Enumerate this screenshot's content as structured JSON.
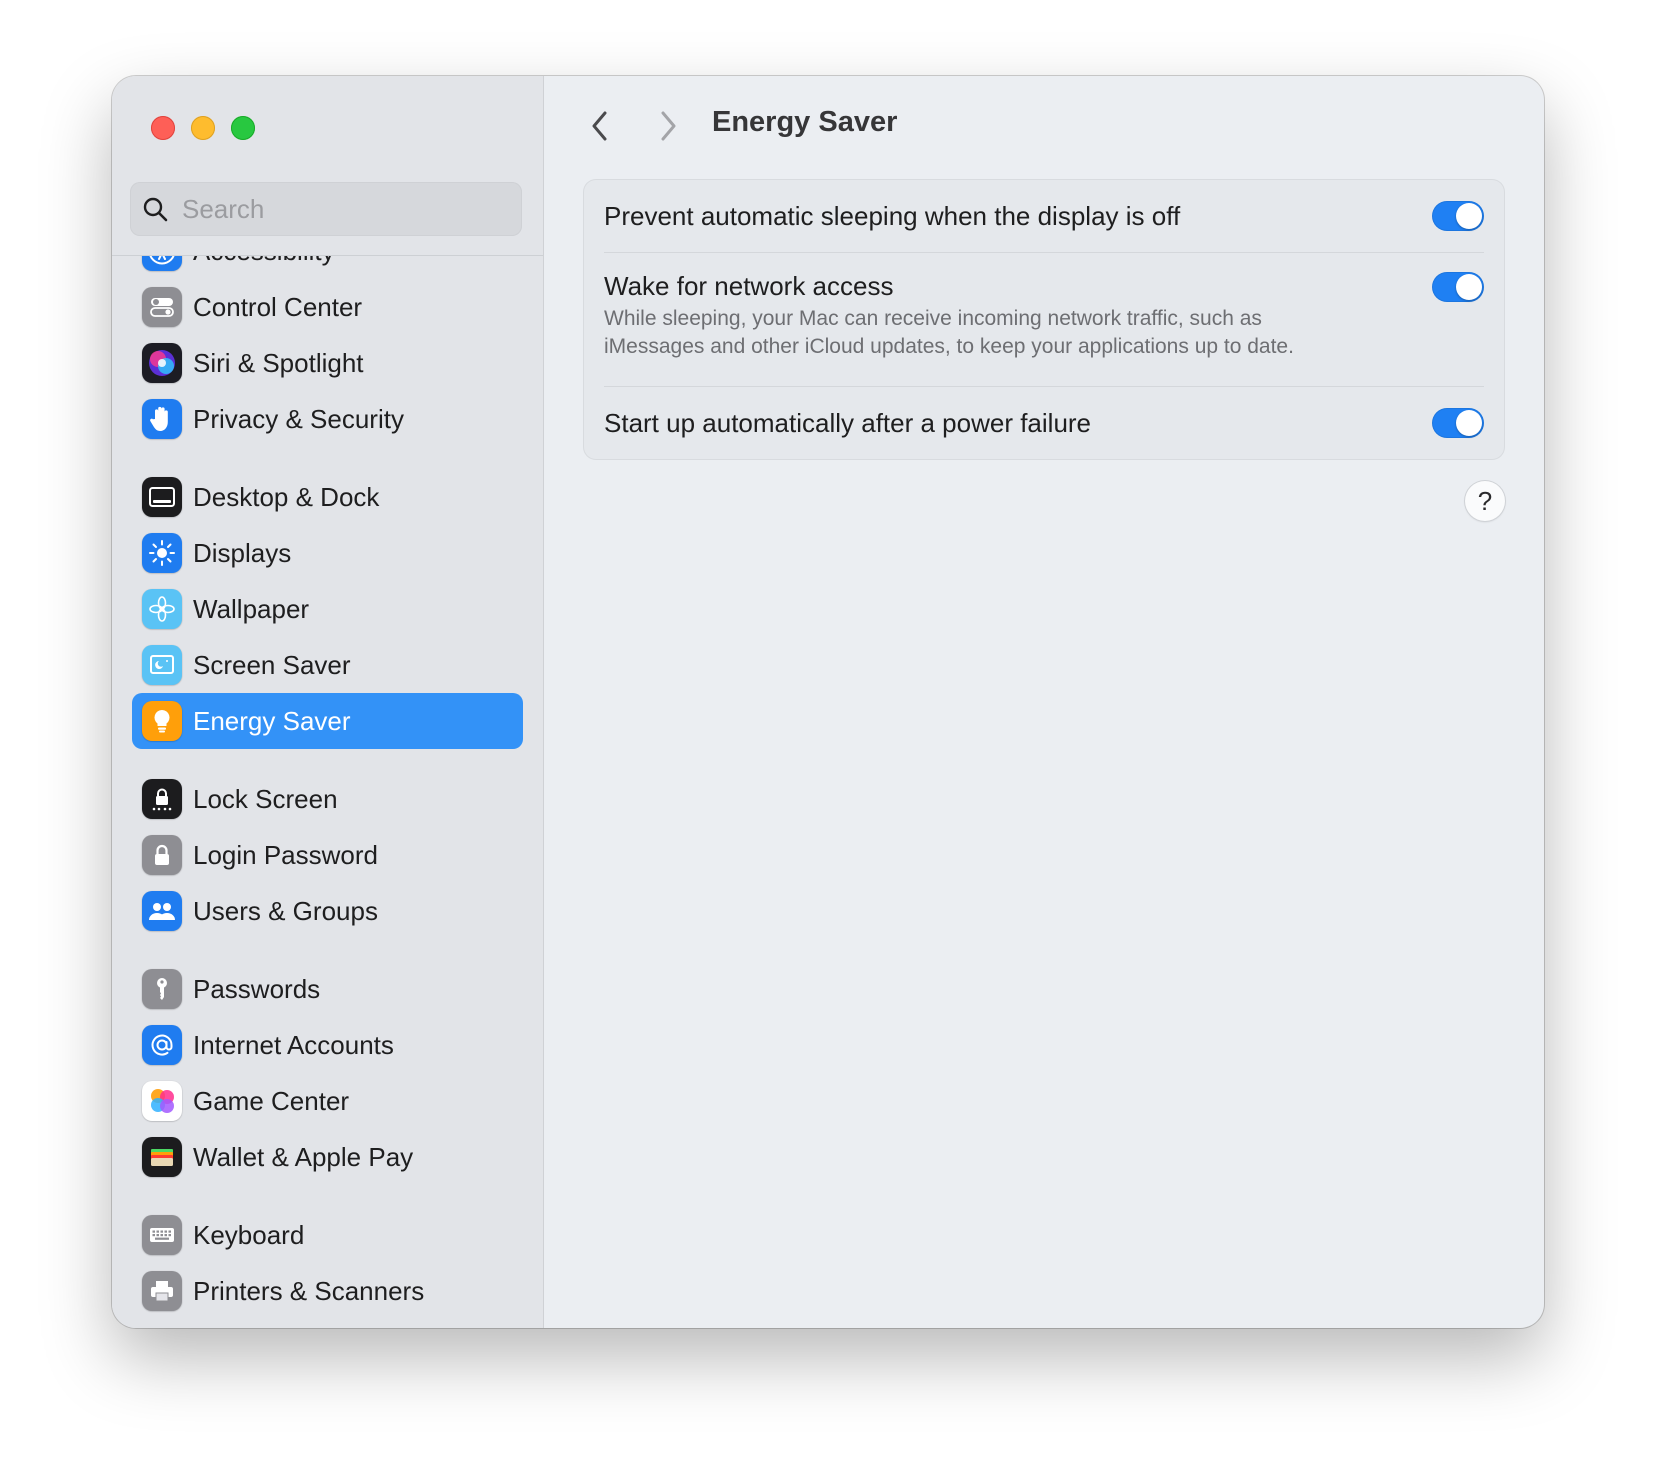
{
  "window": {
    "traffic_lights": [
      "close",
      "minimize",
      "zoom"
    ]
  },
  "search": {
    "placeholder": "Search",
    "icon": "magnifying-glass-icon"
  },
  "sidebar": {
    "groups": [
      {
        "items": [
          {
            "id": "accessibility",
            "label": "Accessibility",
            "icon": "accessibility-icon"
          },
          {
            "id": "control-center",
            "label": "Control Center",
            "icon": "control-center-icon"
          },
          {
            "id": "siri-spotlight",
            "label": "Siri & Spotlight",
            "icon": "siri-icon"
          },
          {
            "id": "privacy-security",
            "label": "Privacy & Security",
            "icon": "hand-icon"
          }
        ]
      },
      {
        "items": [
          {
            "id": "desktop-dock",
            "label": "Desktop & Dock",
            "icon": "dock-icon"
          },
          {
            "id": "displays",
            "label": "Displays",
            "icon": "sun-icon"
          },
          {
            "id": "wallpaper",
            "label": "Wallpaper",
            "icon": "flower-icon"
          },
          {
            "id": "screen-saver",
            "label": "Screen Saver",
            "icon": "screen-saver-icon"
          },
          {
            "id": "energy-saver",
            "label": "Energy Saver",
            "icon": "lightbulb-icon",
            "selected": true
          }
        ]
      },
      {
        "items": [
          {
            "id": "lock-screen",
            "label": "Lock Screen",
            "icon": "lock-screen-icon"
          },
          {
            "id": "login-password",
            "label": "Login Password",
            "icon": "lock-icon"
          },
          {
            "id": "users-groups",
            "label": "Users & Groups",
            "icon": "users-icon"
          }
        ]
      },
      {
        "items": [
          {
            "id": "passwords",
            "label": "Passwords",
            "icon": "key-icon"
          },
          {
            "id": "internet-accounts",
            "label": "Internet Accounts",
            "icon": "at-sign-icon"
          },
          {
            "id": "game-center",
            "label": "Game Center",
            "icon": "game-center-icon"
          },
          {
            "id": "wallet-apple-pay",
            "label": "Wallet & Apple Pay",
            "icon": "wallet-icon"
          }
        ]
      },
      {
        "items": [
          {
            "id": "keyboard",
            "label": "Keyboard",
            "icon": "keyboard-icon"
          },
          {
            "id": "printers-scanners",
            "label": "Printers & Scanners",
            "icon": "printer-icon"
          }
        ]
      }
    ]
  },
  "header": {
    "title": "Energy Saver",
    "back_icon": "chevron-left-icon",
    "forward_icon": "chevron-right-icon"
  },
  "settings": [
    {
      "title": "Prevent automatic sleeping when the display is off",
      "description": "",
      "enabled": true
    },
    {
      "title": "Wake for network access",
      "description_line1": "While sleeping, your Mac can receive incoming network traffic, such as",
      "description_line2": "iMessages and other iCloud updates, to keep your applications up to date.",
      "enabled": true
    },
    {
      "title": "Start up automatically after a power failure",
      "description": "",
      "enabled": true
    }
  ],
  "help": {
    "label": "?"
  },
  "colors": {
    "accent": "#1f80f3",
    "selection": "#3392f7"
  }
}
